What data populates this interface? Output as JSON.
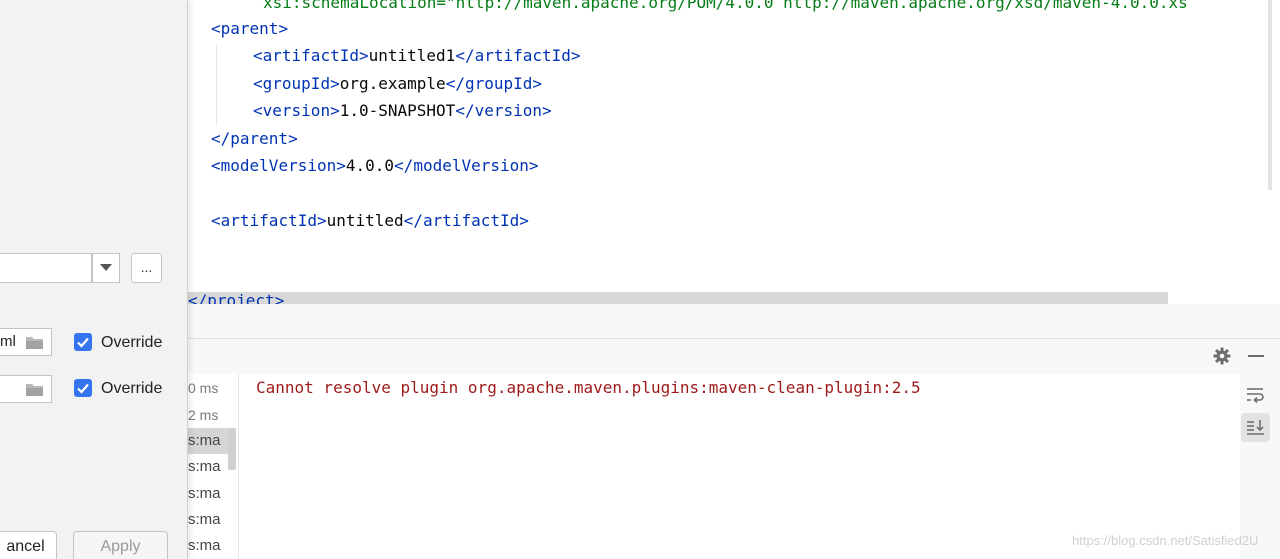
{
  "editor": {
    "lines": {
      "schema_attr": "xsi:schemaLocation=",
      "schema_value": "\"http://maven.apache.org/POM/4.0.0 http://maven.apache.org/xsd/maven-4.0.0.xs",
      "parent_open": "parent",
      "artifactId_tag": "artifactId",
      "artifactId1_value": "untitled1",
      "groupId_tag": "groupId",
      "groupId_value": "org.example",
      "version_tag": "version",
      "version_value": "1.0-SNAPSHOT",
      "parent_close": "parent",
      "modelVersion_tag": "modelVersion",
      "modelVersion_value": "4.0.0",
      "artifactId2_value": "untitled",
      "project_close": "project>"
    }
  },
  "dialog": {
    "browse_button": "...",
    "settings_file_value": "ml",
    "override_label_1": "Override",
    "override_label_2": "Override",
    "cancel_label": "ancel",
    "apply_label": "Apply"
  },
  "run_panel": {
    "tree_items": [
      {
        "text": "0 ms"
      },
      {
        "text": "2 ms"
      },
      {
        "text": "s:ma"
      },
      {
        "text": "s:ma"
      },
      {
        "text": "s:ma"
      },
      {
        "text": "s:ma"
      },
      {
        "text": "s:ma"
      }
    ],
    "console_error": "Cannot resolve plugin org.apache.maven.plugins:maven-clean-plugin:2.5",
    "icons": {
      "settings": "gear-icon",
      "hide": "minimize-icon",
      "wrap": "soft-wrap-icon",
      "scroll_to_end": "scroll-to-end-icon"
    }
  },
  "watermark": "https://blog.csdn.net/Satisfied2U",
  "colors": {
    "tag": "#0033b3",
    "string": "#067d17",
    "error": "#9e1a1a",
    "checkbox": "#3574f0"
  }
}
